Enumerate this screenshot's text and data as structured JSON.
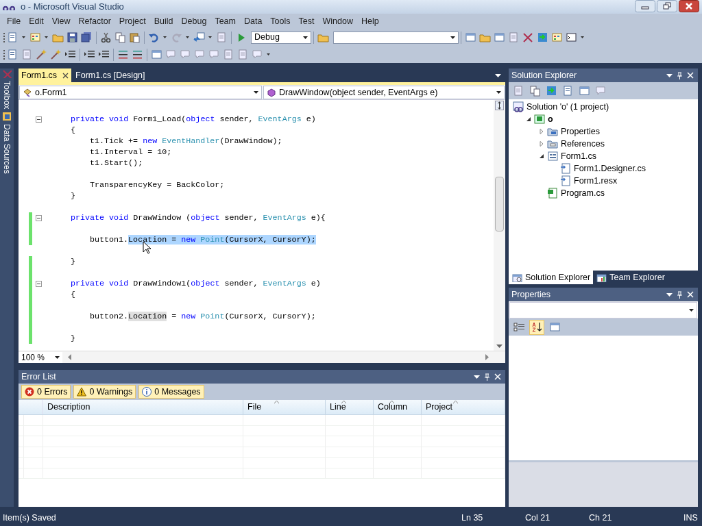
{
  "window": {
    "title": "o - Microsoft Visual Studio"
  },
  "menu": [
    "File",
    "Edit",
    "View",
    "Refactor",
    "Project",
    "Build",
    "Debug",
    "Team",
    "Data",
    "Tools",
    "Test",
    "Window",
    "Help"
  ],
  "toolbar": {
    "configuration": "Debug"
  },
  "side_tabs": [
    "Toolbox",
    "Data Sources"
  ],
  "editor": {
    "tabs": [
      {
        "label": "Form1.cs",
        "selected": true
      },
      {
        "label": "Form1.cs [Design]",
        "selected": false
      }
    ],
    "type_combo": "o.Form1",
    "member_combo": "DrawWindow(object sender, EventArgs e)",
    "lines": [
      {
        "fold": true,
        "changed": false,
        "kind": "member",
        "tokens": [
          {
            "text": "private void ",
            "kind": "keyword"
          },
          {
            "text": "Form1_Load(",
            "kind": "plain"
          },
          {
            "text": "object",
            "kind": "keyword"
          },
          {
            "text": " sender, ",
            "kind": "plain"
          },
          {
            "text": "EventArgs",
            "kind": "type"
          },
          {
            "text": " e)",
            "kind": "plain"
          }
        ]
      },
      {
        "fold": false,
        "changed": false,
        "kind": "member",
        "tokens": [
          {
            "text": "{",
            "kind": "plain"
          }
        ]
      },
      {
        "fold": false,
        "changed": false,
        "kind": "statement",
        "tokens": [
          {
            "text": "t1.Tick += ",
            "kind": "plain"
          },
          {
            "text": "new ",
            "kind": "keyword"
          },
          {
            "text": "EventHandler",
            "kind": "type"
          },
          {
            "text": "(DrawWindow);",
            "kind": "plain"
          }
        ]
      },
      {
        "fold": false,
        "changed": false,
        "kind": "statement",
        "tokens": [
          {
            "text": "t1.Interval = 10;",
            "kind": "plain"
          }
        ]
      },
      {
        "fold": false,
        "changed": false,
        "kind": "statement",
        "tokens": [
          {
            "text": "t1.Start();",
            "kind": "plain"
          }
        ]
      },
      {
        "fold": false,
        "changed": false
      },
      {
        "fold": false,
        "changed": false,
        "kind": "statement",
        "tokens": [
          {
            "text": "TransparencyKey = BackColor;",
            "kind": "plain"
          }
        ]
      },
      {
        "fold": false,
        "changed": false,
        "kind": "member",
        "tokens": [
          {
            "text": "}",
            "kind": "plain"
          }
        ]
      },
      {
        "fold": false,
        "changed": false
      },
      {
        "fold": true,
        "changed": true,
        "kind": "member",
        "tokens": [
          {
            "text": "private void ",
            "kind": "keyword"
          },
          {
            "text": "DrawWindow (",
            "kind": "plain"
          },
          {
            "text": "object",
            "kind": "keyword"
          },
          {
            "text": " sender, ",
            "kind": "plain"
          },
          {
            "text": "EventArgs",
            "kind": "type"
          },
          {
            "text": " e){",
            "kind": "plain"
          }
        ]
      },
      {
        "fold": false,
        "changed": true
      },
      {
        "fold": false,
        "changed": true,
        "kind": "statement",
        "tokens": [
          {
            "text": "button1.",
            "kind": "plain"
          },
          {
            "text": "Location = ",
            "kind": "plain",
            "selected": true
          },
          {
            "text": "new ",
            "kind": "keyword",
            "selected": true
          },
          {
            "text": "Point",
            "kind": "type",
            "selected": true
          },
          {
            "text": "(CursorX, CursorY);",
            "kind": "plain",
            "selected": true
          }
        ]
      },
      {
        "fold": false,
        "changed": false
      },
      {
        "fold": false,
        "changed": true,
        "kind": "member",
        "tokens": [
          {
            "text": "}",
            "kind": "plain"
          }
        ]
      },
      {
        "fold": false,
        "changed": true
      },
      {
        "fold": true,
        "changed": true,
        "kind": "member",
        "tokens": [
          {
            "text": "private void ",
            "kind": "keyword"
          },
          {
            "text": "DrawWindow1(",
            "kind": "plain"
          },
          {
            "text": "object",
            "kind": "keyword"
          },
          {
            "text": " sender, ",
            "kind": "plain"
          },
          {
            "text": "EventArgs",
            "kind": "type"
          },
          {
            "text": " e)",
            "kind": "plain"
          }
        ]
      },
      {
        "fold": false,
        "changed": true,
        "kind": "member",
        "tokens": [
          {
            "text": "{",
            "kind": "plain"
          }
        ]
      },
      {
        "fold": false,
        "changed": true
      },
      {
        "fold": false,
        "changed": true,
        "kind": "statement",
        "tokens": [
          {
            "text": "button2.",
            "kind": "plain"
          },
          {
            "text": "Location",
            "kind": "plain",
            "highlighted": true
          },
          {
            "text": " = ",
            "kind": "plain"
          },
          {
            "text": "new ",
            "kind": "keyword"
          },
          {
            "text": "Point",
            "kind": "type"
          },
          {
            "text": "(CursorX, CursorY);",
            "kind": "plain"
          }
        ]
      },
      {
        "fold": false,
        "changed": true
      },
      {
        "fold": false,
        "changed": true,
        "kind": "member",
        "tokens": [
          {
            "text": "}",
            "kind": "plain"
          }
        ]
      }
    ],
    "zoom": "100 %"
  },
  "error_list": {
    "title": "Error List",
    "filters": [
      {
        "kind": "error",
        "label": "0 Errors"
      },
      {
        "kind": "warning",
        "label": "0 Warnings"
      },
      {
        "kind": "info",
        "label": "0 Messages"
      }
    ],
    "columns": [
      {
        "label": "Description",
        "sort_arrow": false
      },
      {
        "label": "File",
        "sort_arrow": true
      },
      {
        "label": "Line",
        "sort_arrow": true
      },
      {
        "label": "Column",
        "sort_arrow": true
      },
      {
        "label": "Project",
        "sort_arrow": true
      }
    ]
  },
  "solution_explorer": {
    "title": "Solution Explorer",
    "tree": [
      {
        "label": "Solution 'o' (1 project)",
        "kind": "solution",
        "children": [
          {
            "label": "o",
            "kind": "project",
            "expanded": true,
            "children": [
              {
                "label": "Properties",
                "kind": "properties",
                "expanded": false
              },
              {
                "label": "References",
                "kind": "references",
                "expanded": false
              },
              {
                "label": "Form1.cs",
                "kind": "form",
                "expanded": true,
                "children": [
                  {
                    "label": "Form1.Designer.cs",
                    "kind": "dependent"
                  },
                  {
                    "label": "Form1.resx",
                    "kind": "dependent"
                  }
                ]
              },
              {
                "label": "Program.cs",
                "kind": "code"
              }
            ]
          }
        ]
      }
    ],
    "tabs": [
      {
        "label": "Solution Explorer",
        "selected": true
      },
      {
        "label": "Team Explorer",
        "selected": false
      }
    ]
  },
  "properties": {
    "title": "Properties",
    "sort_buttons": [
      {
        "kind": "categorized",
        "selected": false
      },
      {
        "kind": "alphabetical",
        "selected": true
      },
      {
        "kind": "pages",
        "selected": false
      }
    ]
  },
  "status_bar": {
    "message": "Item(s) Saved",
    "line": "Ln 35",
    "column": "Col 21",
    "char": "Ch 21",
    "mode": "INS"
  }
}
